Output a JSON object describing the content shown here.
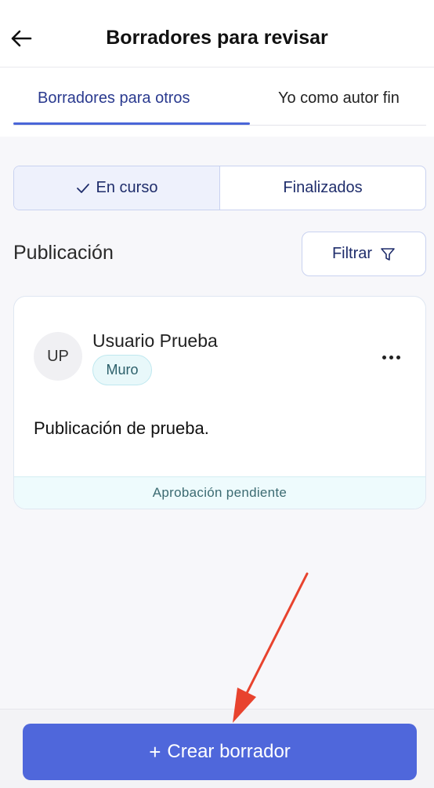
{
  "header": {
    "title": "Borradores para revisar",
    "back_icon": "arrow-left-icon"
  },
  "tabs": [
    {
      "label": "Borradores para otros",
      "active": true
    },
    {
      "label": "Yo como autor fin",
      "active": false
    }
  ],
  "status_filter": {
    "options": [
      {
        "label": "En curso",
        "selected": true,
        "icon": "check-icon"
      },
      {
        "label": "Finalizados",
        "selected": false
      }
    ]
  },
  "section": {
    "title": "Publicación",
    "filter_label": "Filtrar",
    "filter_icon": "funnel-icon"
  },
  "posts": [
    {
      "avatar_initials": "UP",
      "author": "Usuario Prueba",
      "tag": "Muro",
      "text": "Publicación de prueba.",
      "status": "Aprobación pendiente"
    }
  ],
  "footer": {
    "create_label": "Crear borrador",
    "create_icon": "plus-icon"
  },
  "colors": {
    "accent": "#4f67db",
    "annotation_arrow": "#e8432e"
  }
}
